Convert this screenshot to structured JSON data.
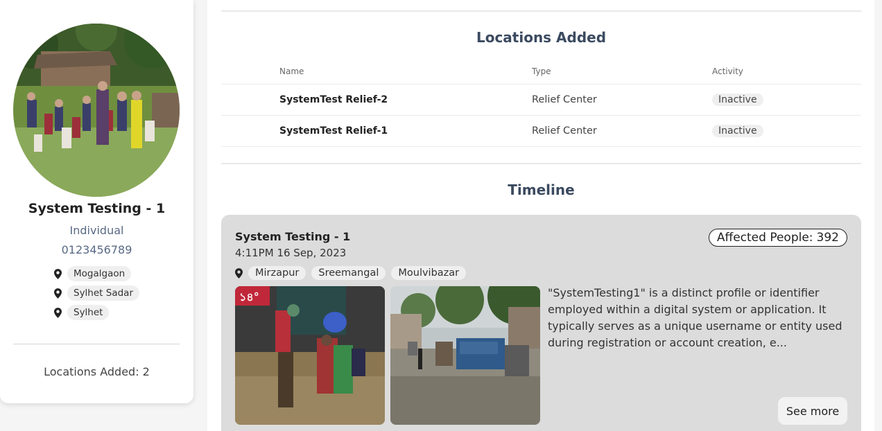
{
  "profile": {
    "name": "System Testing - 1",
    "type": "Individual",
    "phone": "0123456789",
    "locations": [
      "Mogalgaon",
      "Sylhet Sadar",
      "Sylhet"
    ],
    "locations_added_label": "Locations Added: 2"
  },
  "locations_section": {
    "title": "Locations Added",
    "columns": {
      "name": "Name",
      "type": "Type",
      "activity": "Activity"
    },
    "rows": [
      {
        "name": "SystemTest Relief-2",
        "type": "Relief Center",
        "activity": "Inactive"
      },
      {
        "name": "SystemTest Relief-1",
        "type": "Relief Center",
        "activity": "Inactive"
      }
    ]
  },
  "timeline": {
    "title": "Timeline",
    "entries": [
      {
        "title": "System Testing - 1",
        "time": "4:11PM 16 Sep, 2023",
        "affected_label": "Affected People:",
        "affected_count": "392",
        "locations": [
          "Mirzapur",
          "Sreemangal",
          "Moulvibazar"
        ],
        "description": "\"SystemTesting1\" is a distinct profile or identifier employed within a digital system or application. It typically serves as a unique username or entity used during registration or account creation, e...",
        "see_more_label": "See more",
        "photo_badge": "১৪°"
      }
    ]
  },
  "colors": {
    "heading": "#3b4a60",
    "muted": "#5a6a85",
    "card_bg": "#dcdcdc",
    "chip_bg": "#efefef"
  },
  "icons": {
    "location": "location-pin-icon"
  }
}
